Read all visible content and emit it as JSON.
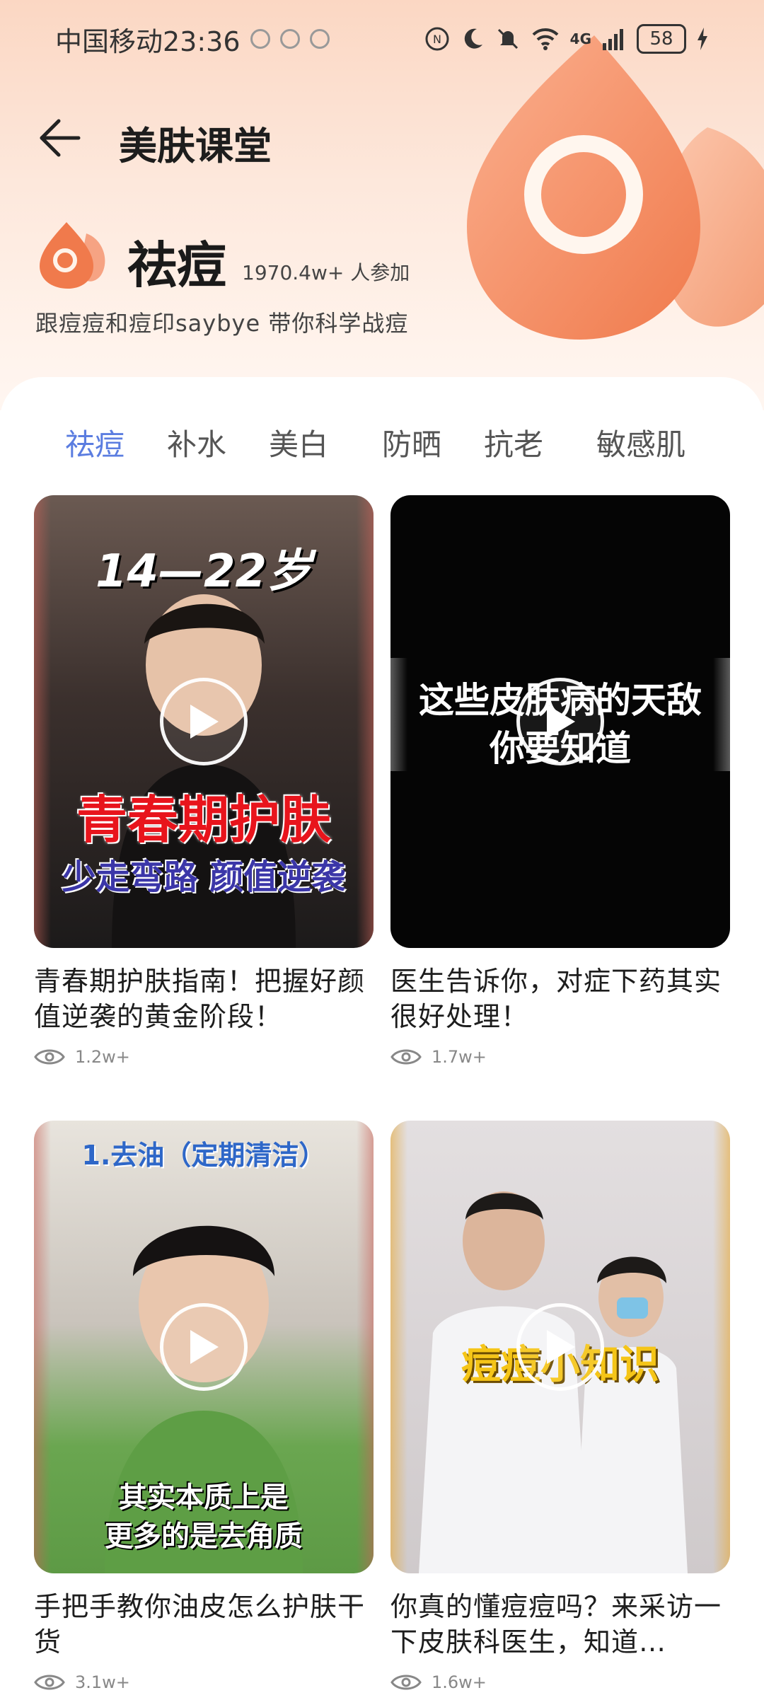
{
  "status_bar": {
    "carrier_time": "中国移动23:36",
    "network": "4G",
    "battery": "58"
  },
  "header": {
    "title": "美肤课堂"
  },
  "topic": {
    "name": "祛痘",
    "participants": "1970.4w+ 人参加",
    "description": "跟痘痘和痘印saybye 带你科学战痘"
  },
  "tabs": [
    {
      "label": "祛痘",
      "active": true
    },
    {
      "label": "补水",
      "active": false
    },
    {
      "label": "美白",
      "active": false
    },
    {
      "label": "防晒",
      "active": false
    },
    {
      "label": "抗老",
      "active": false
    },
    {
      "label": "敏感肌",
      "active": false
    }
  ],
  "videos": [
    {
      "title": "青春期护肤指南！把握好颜值逆袭的黄金阶段！",
      "views": "1.2w+",
      "overlay_top": "14—22岁",
      "overlay_main": "青春期护肤",
      "overlay_sub": "少走弯路 颜值逆袭"
    },
    {
      "title": "医生告诉你，对症下药其实很好处理！",
      "views": "1.7w+",
      "overlay_line1": "这些皮肤病的天敌",
      "overlay_line2": "你要知道"
    },
    {
      "title": "手把手教你油皮怎么护肤干货",
      "views": "3.1w+",
      "overlay_top": "1.去油（定期清洁）",
      "overlay_line1": "其实本质上是",
      "overlay_line2": "更多的是去角质"
    },
    {
      "title": "你真的懂痘痘吗？来采访一下皮肤科医生，知道…",
      "views": "1.6w+",
      "overlay_main": "痘痘小知识"
    }
  ],
  "colors": {
    "accent": "#5b7de0",
    "header_peach": "#fbd7c3",
    "logo_orange": "#f07a4c"
  }
}
